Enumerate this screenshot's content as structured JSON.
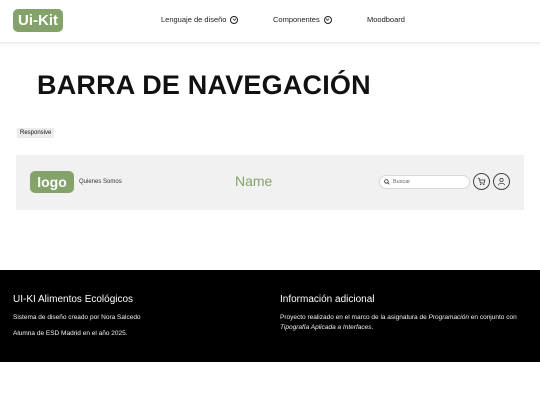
{
  "topnav": {
    "brand": "Ui-Kit",
    "items": [
      {
        "label": "Lenguaje de diseño",
        "has_dropdown": true
      },
      {
        "label": "Componentes",
        "has_dropdown": true
      },
      {
        "label": "Moodboard",
        "has_dropdown": false
      }
    ]
  },
  "page": {
    "title": "BARRA DE NAVEGACIÓN",
    "tag": "Responsive"
  },
  "demo_navbar": {
    "logo": "logo",
    "link": "Quienes Somos",
    "name": "Name",
    "search_placeholder": "Buscar",
    "icons": [
      "search-icon",
      "cart-icon",
      "user-icon"
    ]
  },
  "footer": {
    "left_title": "UI-KI Alimentos Ecológicos",
    "left_line1": "Sistema de diseño creado por Nora Salcedo",
    "left_line2": "Alumna de ESD Madrid en el año 2025.",
    "right_title": "Información adicional",
    "right_text_a": "Proyecto realizado en el marco de la asignatura de ",
    "right_text_em1": "Programación",
    "right_text_b": " en conjunto con ",
    "right_text_em2": "Tipografía Aplicada a Interfaces",
    "right_text_c": "."
  },
  "colors": {
    "accent_green": "#83a36a",
    "footer_bg": "#000000",
    "demo_bar_bg": "#f1f1f1"
  }
}
